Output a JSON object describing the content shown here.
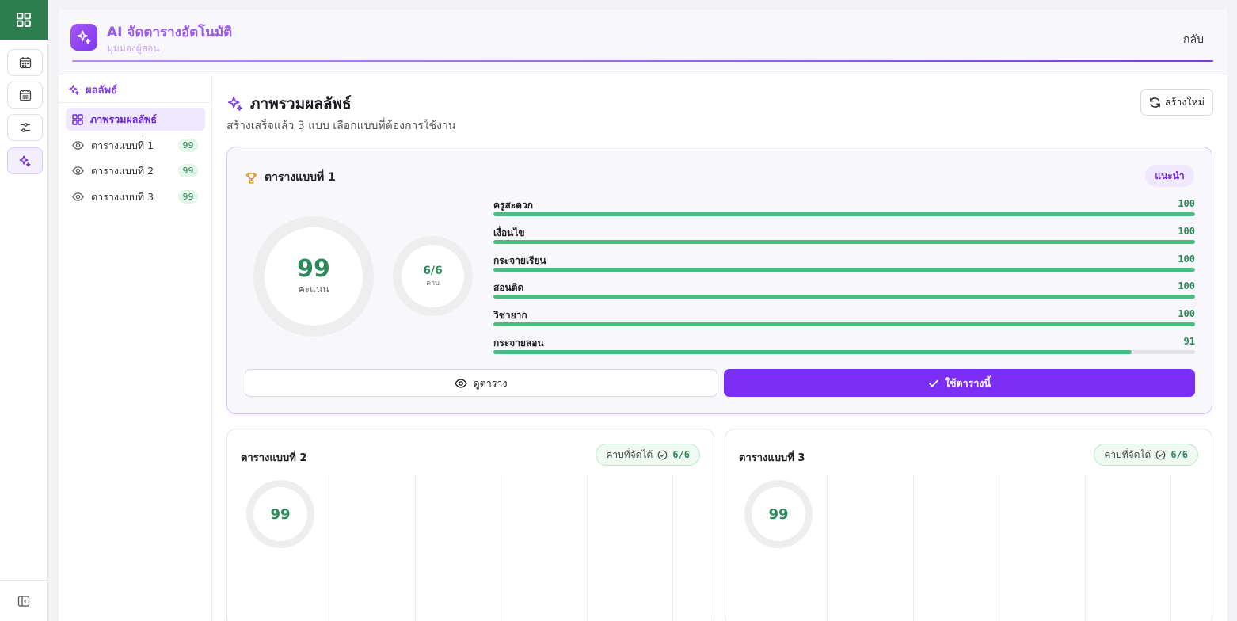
{
  "header": {
    "title": "AI จัดตารางอัตโนมัติ",
    "subtitle": "มุมมองผู้สอน",
    "back_label": "กลับ"
  },
  "sidenav": {
    "heading": "ผลลัพธ์",
    "items": [
      {
        "label": "ภาพรวมผลลัพธ์",
        "badge": ""
      },
      {
        "label": "ตารางแบบที่ 1",
        "badge": "99"
      },
      {
        "label": "ตารางแบบที่ 2",
        "badge": "99"
      },
      {
        "label": "ตารางแบบที่ 3",
        "badge": "99"
      }
    ]
  },
  "content": {
    "title": "ภาพรวมผลลัพธ์",
    "subtitle": "สร้างเสร็จแล้ว 3 แบบ เลือกแบบที่ต้องการใช้งาน",
    "regen_label": "สร้างใหม่"
  },
  "featured": {
    "title": "ตารางแบบที่ 1",
    "badge": "แนะนำ",
    "score": "99",
    "score_label": "คะแนน",
    "periods": "6/6",
    "periods_label": "คาบ",
    "metrics": [
      {
        "label": "ครูสะดวก",
        "value": "100",
        "pct": 1.0
      },
      {
        "label": "เงื่อนไข",
        "value": "100",
        "pct": 1.0
      },
      {
        "label": "กระจายเรียน",
        "value": "100",
        "pct": 1.0
      },
      {
        "label": "สอนติด",
        "value": "100",
        "pct": 1.0
      },
      {
        "label": "วิชายาก",
        "value": "100",
        "pct": 1.0
      },
      {
        "label": "กระจายสอน",
        "value": "91",
        "pct": 0.91
      }
    ],
    "view_label": "ดูตาราง",
    "use_label": "ใช้ตารางนี้"
  },
  "others": [
    {
      "title": "ตารางแบบที่ 2",
      "pill_label": "คาบที่จัดได้",
      "pill_value": "6/6",
      "score": "99"
    },
    {
      "title": "ตารางแบบที่ 3",
      "pill_label": "คาบที่จัดได้",
      "pill_value": "6/6",
      "score": "99"
    }
  ],
  "colors": {
    "accent": "#7b2ff2",
    "success": "#2e8a5a",
    "bar": "#4cbb7f",
    "rail_top": "#2e7d4f"
  }
}
